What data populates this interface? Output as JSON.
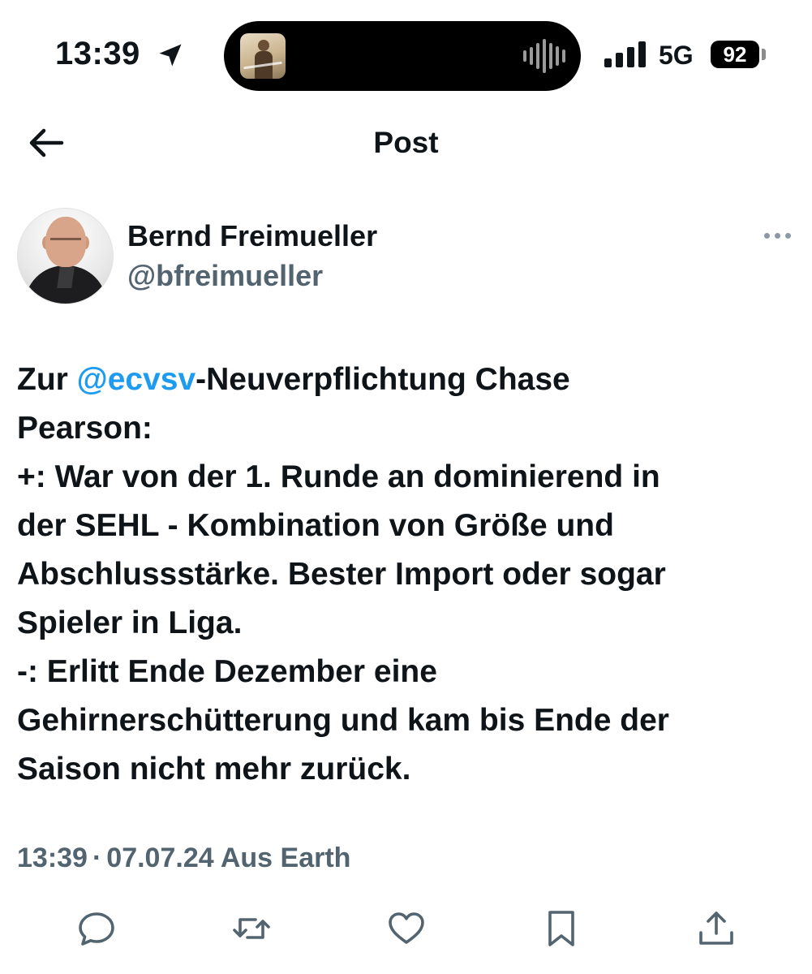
{
  "status_bar": {
    "time": "13:39",
    "network": "5G",
    "battery": "92",
    "icons": {
      "location": "location-arrow-icon",
      "signal": "cellular-signal-icon",
      "battery": "battery-icon",
      "waveform": "audio-waveform-icon",
      "artwork": "now-playing-artwork"
    }
  },
  "header": {
    "title": "Post",
    "back_icon": "arrow-left-icon"
  },
  "author": {
    "name": "Bernd Freimueller",
    "handle": "@bfreimueller",
    "more_icon": "more-horizontal-icon"
  },
  "tweet": {
    "line1_prefix": "Zur ",
    "mention": "@ecvsv",
    "line1_suffix": "-Neuverpflichtung Chase",
    "lines": [
      "Pearson:",
      "+: War von der 1. Runde an dominierend in",
      "der SEHL - Kombination von Größe und",
      "Abschlussstärke. Bester Import oder sogar",
      "Spieler in Liga.",
      "-: Erlitt Ende Dezember eine",
      "Gehirnerschütterung und kam bis Ende der",
      "Saison nicht mehr zurück."
    ]
  },
  "meta": {
    "time": "13:39",
    "separator": "·",
    "date": "07.07.24",
    "location": "Aus Earth"
  },
  "actions": {
    "reply": "reply-icon",
    "repost": "repost-icon",
    "like": "like-heart-icon",
    "bookmark": "bookmark-icon",
    "share": "share-icon"
  },
  "colors": {
    "text": "#0f1419",
    "secondary": "#536471",
    "accent": "#1d9bf0",
    "background": "#ffffff"
  }
}
